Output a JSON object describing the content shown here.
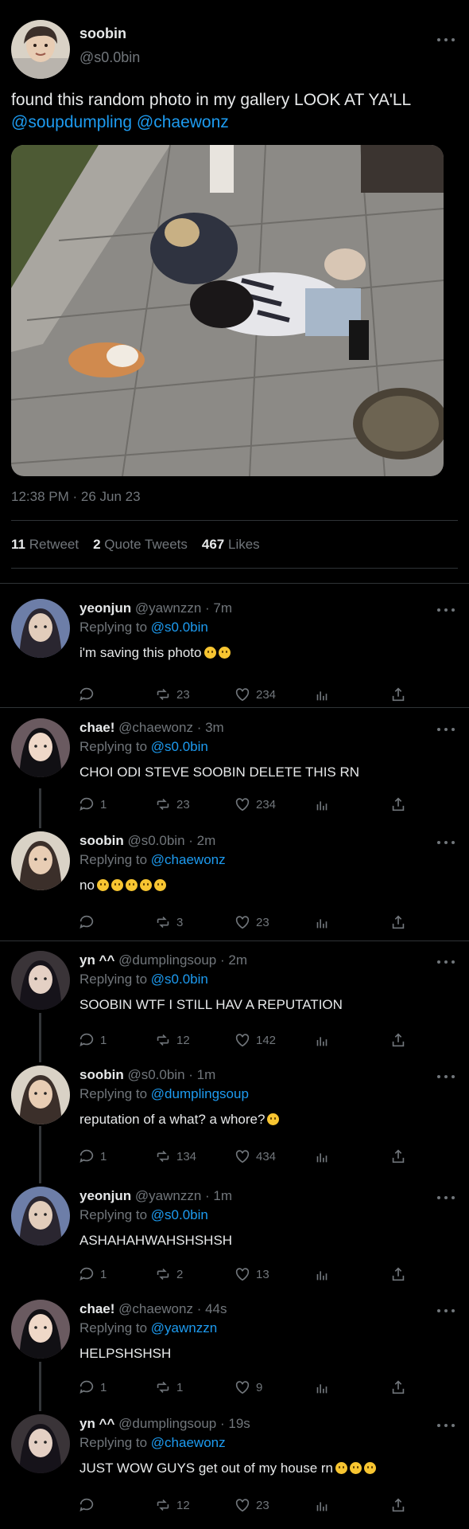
{
  "main_tweet": {
    "name": "soobin",
    "handle": "@s0.0bin",
    "text": "found this random photo in my gallery LOOK AT YA'LL",
    "mentions": "@soupdumpling @chaewonz",
    "time": "12:38 PM · 26 Jun 23",
    "stats": {
      "retweets_count": "11",
      "retweets_label": "Retweet",
      "quotes_count": "2",
      "quotes_label": "Quote Tweets",
      "likes_count": "467",
      "likes_label": "Likes"
    }
  },
  "replies": [
    {
      "name": "yeonjun",
      "handle": "@yawnzzn",
      "time": "· 7m",
      "replying_prefix": "Replying to",
      "replying_to": "@s0.0bin",
      "text": "i'm saving this photo",
      "emoji_count": 2,
      "reply_count": "",
      "retweets": "23",
      "likes": "234"
    },
    {
      "name": "chae!",
      "handle": "@chaewonz",
      "time": "· 3m",
      "replying_prefix": "Replying to",
      "replying_to": "@s0.0bin",
      "text": "CHOI ODI STEVE SOOBIN DELETE THIS RN",
      "emoji_count": 0,
      "reply_count": "1",
      "retweets": "23",
      "likes": "234"
    },
    {
      "name": "soobin",
      "handle": "@s0.0bin",
      "time": "· 2m",
      "replying_prefix": "Replying to",
      "replying_to": "@chaewonz",
      "text": "no",
      "emoji_count": 5,
      "reply_count": "",
      "retweets": "3",
      "likes": "23"
    },
    {
      "name": "yn ^^",
      "handle": "@dumplingsoup",
      "time": "· 2m",
      "replying_prefix": "Replying to",
      "replying_to": "@s0.0bin",
      "text": "SOOBIN WTF I STILL HAV A REPUTATION",
      "emoji_count": 0,
      "reply_count": "1",
      "retweets": "12",
      "likes": "142"
    },
    {
      "name": "soobin",
      "handle": "@s0.0bin",
      "time": "· 1m",
      "replying_prefix": "Replying to",
      "replying_to": "@dumplingsoup",
      "text": "reputation of a what? a whore?",
      "emoji_count": 1,
      "reply_count": "1",
      "retweets": "134",
      "likes": "434"
    },
    {
      "name": "yeonjun",
      "handle": "@yawnzzn",
      "time": "· 1m",
      "replying_prefix": "Replying to",
      "replying_to": "@s0.0bin",
      "text": "ASHAHAHWAHSHSHSH",
      "emoji_count": 0,
      "reply_count": "1",
      "retweets": "2",
      "likes": "13"
    },
    {
      "name": "chae!",
      "handle": "@chaewonz",
      "time": "· 44s",
      "replying_prefix": "Replying to",
      "replying_to": "@yawnzzn",
      "text": "HELPSHSHSH",
      "emoji_count": 0,
      "reply_count": "1",
      "retweets": "1",
      "likes": "9"
    },
    {
      "name": "yn ^^",
      "handle": "@dumplingsoup",
      "time": "· 19s",
      "replying_prefix": "Replying to",
      "replying_to": "@chaewonz",
      "text": "JUST WOW GUYS get out of my house rn",
      "emoji_count": 3,
      "reply_count": "",
      "retweets": "12",
      "likes": "23"
    }
  ],
  "colors": {
    "background": "#000000",
    "text": "#e7e9ea",
    "muted": "#71767b",
    "link": "#1d9bf0",
    "divider": "#2f3336"
  },
  "icons": [
    "more-icon",
    "reply-icon",
    "retweet-icon",
    "like-icon",
    "analytics-icon",
    "share-icon"
  ]
}
